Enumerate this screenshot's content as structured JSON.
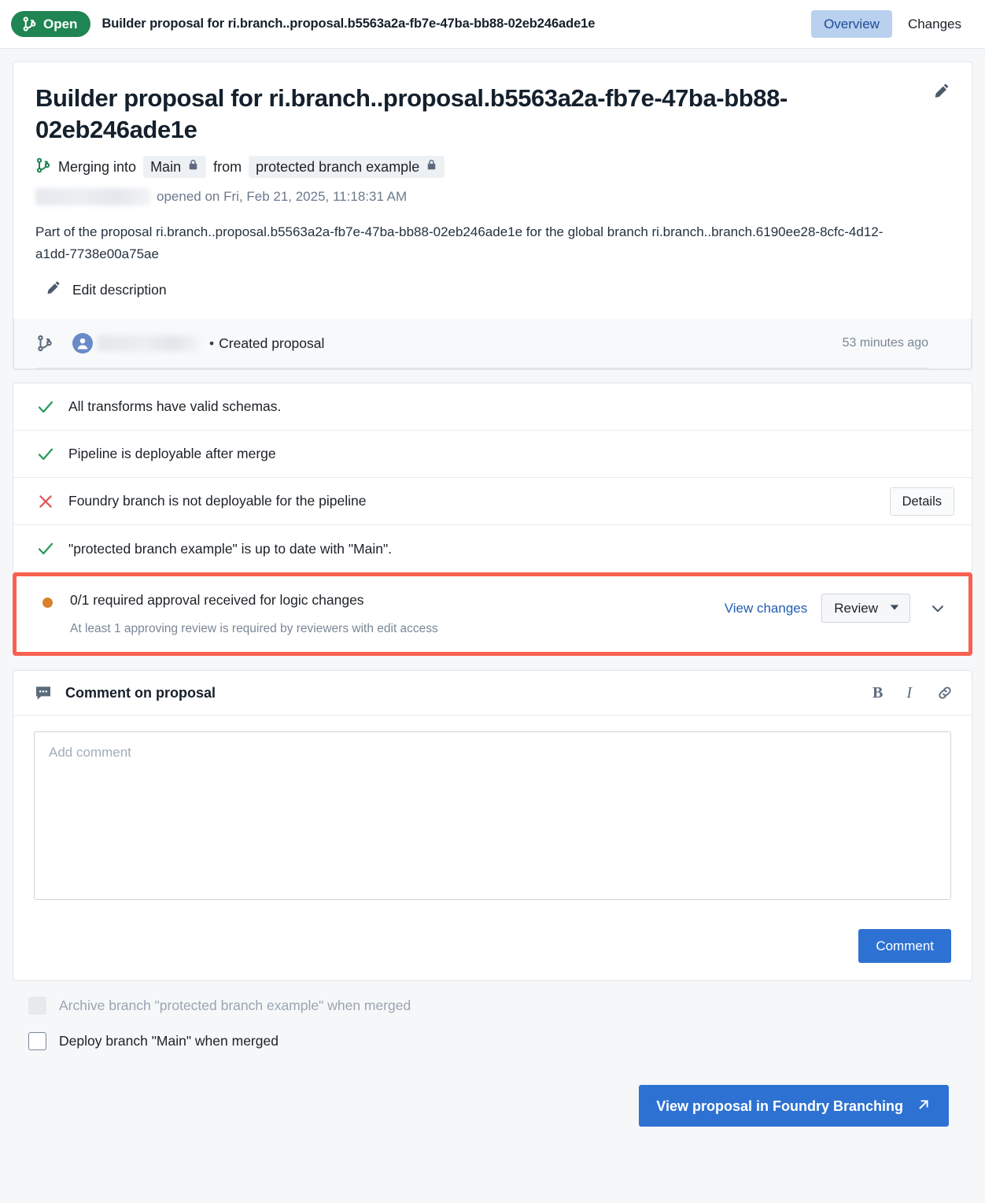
{
  "topbar": {
    "status_label": "Open",
    "status_color": "#1f8552",
    "title": "Builder proposal for ri.branch..proposal.b5563a2a-fb7e-47ba-bb88-02eb246ade1e",
    "tabs": [
      {
        "label": "Overview",
        "active": true
      },
      {
        "label": "Changes",
        "active": false
      }
    ]
  },
  "header": {
    "title": "Builder proposal for ri.branch..proposal.b5563a2a-fb7e-47ba-bb88-02eb246ade1e",
    "merging_prefix": "Merging into",
    "target_branch": "Main",
    "from_word": "from",
    "source_branch": "protected branch example",
    "opened_text": "opened on Fri, Feb 21, 2025, 11:18:31 AM",
    "description": "Part of the proposal ri.branch..proposal.b5563a2a-fb7e-47ba-bb88-02eb246ade1e for the global branch ri.branch..branch.6190ee28-8cfc-4d12-a1dd-7738e00a75ae",
    "edit_description_label": "Edit description"
  },
  "timeline": {
    "separator": "•",
    "event_label": "Created proposal",
    "timestamp": "53 minutes ago"
  },
  "checks": [
    {
      "status": "pass",
      "label": "All transforms have valid schemas.",
      "action": null
    },
    {
      "status": "pass",
      "label": "Pipeline is deployable after merge",
      "action": null
    },
    {
      "status": "fail",
      "label": "Foundry branch is not deployable for the pipeline",
      "action": "Details"
    },
    {
      "status": "pass",
      "label": "\"protected branch example\" is up to date with \"Main\".",
      "action": null
    }
  ],
  "approval": {
    "title": "0/1 required approval received for logic changes",
    "subtitle": "At least 1 approving review is required by reviewers with edit access",
    "view_changes_label": "View changes",
    "review_button_label": "Review",
    "highlight_color": "#f9604f",
    "status_color": "#d9822b"
  },
  "comment": {
    "header_title": "Comment on proposal",
    "tools": [
      "bold",
      "italic",
      "link"
    ],
    "bold_label": "B",
    "italic_label": "I",
    "input_value": "",
    "input_placeholder": "Add comment",
    "submit_label": "Comment"
  },
  "footer": {
    "checkboxes": [
      {
        "label": "Archive branch \"protected branch example\" when merged",
        "checked": false,
        "disabled": true
      },
      {
        "label": "Deploy branch \"Main\" when merged",
        "checked": false,
        "disabled": false
      }
    ],
    "cta_label": "View proposal in Foundry Branching"
  }
}
